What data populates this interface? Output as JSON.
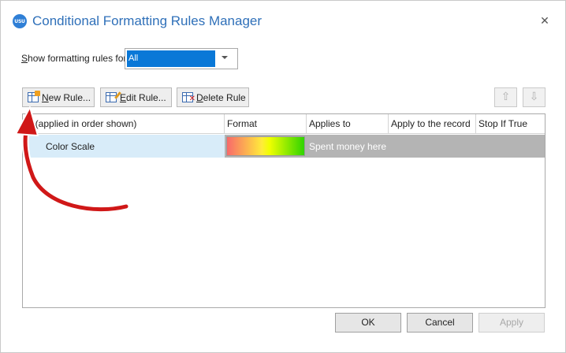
{
  "window": {
    "title": "Conditional Formatting Rules Manager",
    "app_icon_text": "USU",
    "close_glyph": "✕"
  },
  "filter": {
    "label_prefix": "S",
    "label_rest": "how formatting rules for:",
    "selected_value": "All"
  },
  "toolbar": {
    "new_rule_prefix": "N",
    "new_rule_rest": "ew Rule...",
    "edit_rule_prefix": "E",
    "edit_rule_rest": "dit Rule...",
    "delete_rule_prefix": "D",
    "delete_rule_rest": "elete Rule",
    "move_up_glyph": "⇧",
    "move_down_glyph": "⇩"
  },
  "table": {
    "columns": [
      "le (applied in order shown)",
      "Format",
      "Applies to",
      "Apply to the record",
      "Stop If True"
    ],
    "rows": [
      {
        "rule": "Color Scale",
        "format": "color-scale-red-yellow-green",
        "applies_to": "Spent money here",
        "apply_to_record": "",
        "stop_if_true": ""
      }
    ]
  },
  "footer": {
    "ok_label": "OK",
    "cancel_label": "Cancel",
    "apply_label": "Apply"
  },
  "colors": {
    "title": "#2f70b9",
    "selection": "#0a78d7",
    "row_selected": "#d8ecf9",
    "row_disabled": "#b4b4b4",
    "annotation_arrow": "#d01818"
  }
}
